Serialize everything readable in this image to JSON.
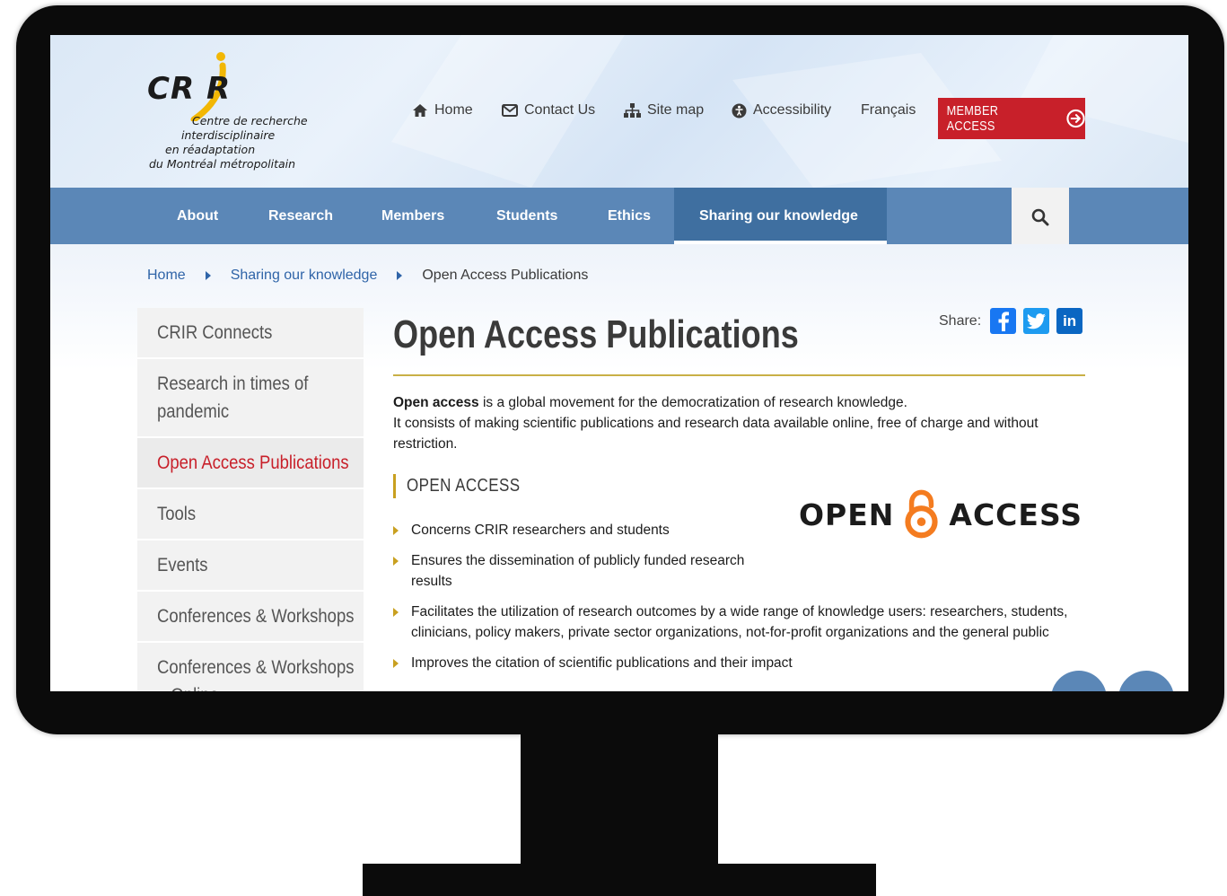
{
  "logo": {
    "mark": "CR R",
    "lines": [
      "Centre de recherche",
      "interdisciplinaire",
      "en réadaptation",
      "du Montréal métropolitain"
    ]
  },
  "topnav": {
    "home": "Home",
    "contact": "Contact Us",
    "sitemap": "Site map",
    "accessibility": "Accessibility",
    "language": "Français",
    "member_access": "MEMBER ACCESS"
  },
  "mainnav": {
    "items": [
      "About",
      "Research",
      "Members",
      "Students",
      "Ethics",
      "Sharing our knowledge"
    ],
    "active": "Sharing our knowledge"
  },
  "breadcrumb": {
    "home": "Home",
    "section": "Sharing our knowledge",
    "current": "Open Access Publications"
  },
  "sidebar": {
    "items": [
      "CRIR Connects",
      "Research in times of",
      "pandemic",
      "Open Access Publications",
      "Tools",
      "Events",
      "Conferences & Workshops",
      "Conferences & Workshops",
      "– Online"
    ]
  },
  "page": {
    "title": "Open Access Publications",
    "share_label": "Share:",
    "intro_bold": "Open access",
    "intro_rest": " is a global movement for the democratization of research knowledge.",
    "intro_line2": "It consists of making scientific publications and research data available online, free of charge and without restriction.",
    "section_heading": "OPEN ACCESS",
    "bullets": [
      "Concerns CRIR researchers and students",
      "Ensures the dissemination of publicly funded research results",
      "Facilitates the utilization of research outcomes by a wide range of knowledge users: researchers, students, clinicians, policy makers, private sector organizations, not-for-profit organizations and the general public",
      "Improves the citation of scientific publications and their impact"
    ],
    "oa_logo_left": "OPEN",
    "oa_logo_right": "ACCESS"
  },
  "colors": {
    "brand_red": "#c8202a",
    "nav_blue": "#5b87b7",
    "nav_active": "#3f6fa0",
    "accent_gold": "#c9a020",
    "link_blue": "#2f64a8",
    "oa_orange": "#f47c20"
  },
  "icons": [
    "home-icon",
    "mail-icon",
    "sitemap-icon",
    "accessibility-icon",
    "arrow-circle-right-icon",
    "search-icon",
    "facebook-icon",
    "twitter-icon",
    "linkedin-icon"
  ]
}
